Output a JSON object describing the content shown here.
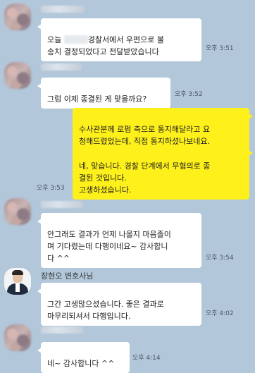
{
  "messages": [
    {
      "text": "오늘 [redacted]경찰서에서 우편으로 불\n송치 결정되었다고 전달받았습니다",
      "prefix": "오늘 ",
      "line1_rest": "경찰서에서 우편으로 불",
      "line2": "송치 결정되었다고 전달받았습니다",
      "time": "오후 3:51"
    },
    {
      "text": "그럼 이제 종결된 게 맞을까요?",
      "time": "오후 3:52"
    },
    {
      "text": "수사관분께 로펌 측으로 통지해달라고 요\n청해드렸었는데, 직접 통지하셨나보네요."
    },
    {
      "text": "네, 맞습니다. 경찰 단계에서 무혐의로 종\n결된 것입니다.\n고생하셨습니다.",
      "time": "오후 3:53"
    },
    {
      "text": "안그래도 결과가 언제 나올지 마음졸이\n며 기다렸는데 다행이네요~ 감사합니\n다 ^^",
      "time": "오후 3:54"
    },
    {
      "sender": "장현오 변호사님",
      "text": "그간 고생많으셨습니다. 좋은 결과로\n마무리되셔서 다행입니다.",
      "time": "오후 4:02"
    },
    {
      "text": "네~ 감사합니다 ^^",
      "time": "오후 4:14"
    }
  ]
}
